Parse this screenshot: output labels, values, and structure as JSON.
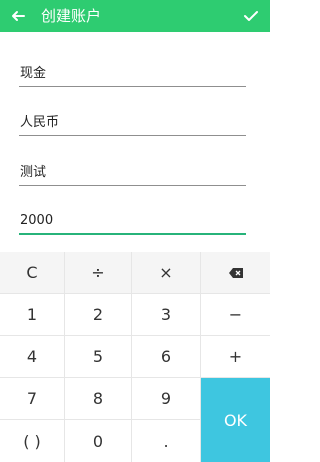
{
  "appbar": {
    "title": "创建账户",
    "back_icon": "arrow-left-icon",
    "confirm_icon": "check-icon",
    "color": "#2ecc71"
  },
  "form": {
    "fields": [
      {
        "name": "account-type-field",
        "value": "现金"
      },
      {
        "name": "currency-field",
        "value": "人民币"
      },
      {
        "name": "account-name-field",
        "value": "测试"
      },
      {
        "name": "balance-field",
        "value": "2000"
      }
    ]
  },
  "keypad": {
    "rows": [
      [
        "C",
        "÷",
        "×",
        "backspace-icon"
      ],
      [
        "1",
        "2",
        "3",
        "−"
      ],
      [
        "4",
        "5",
        "6",
        "+"
      ],
      [
        "7",
        "8",
        "9",
        "OK"
      ],
      [
        "( )",
        "0",
        "."
      ]
    ],
    "ok_color": "#3ec6e0"
  }
}
